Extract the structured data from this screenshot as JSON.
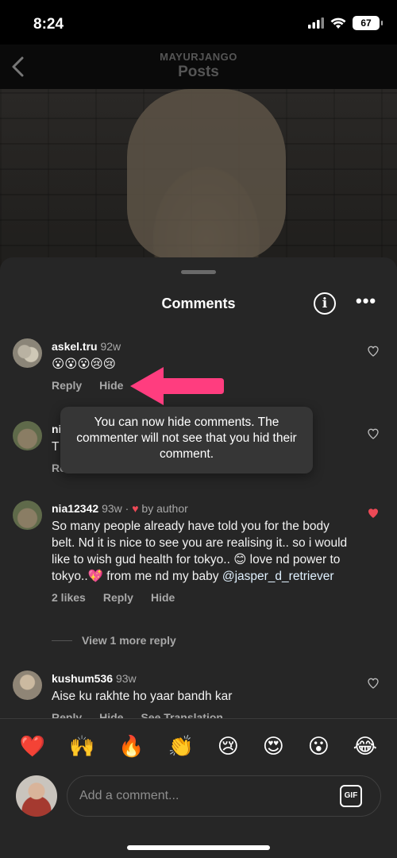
{
  "status_bar": {
    "time": "8:24",
    "battery": "67"
  },
  "header": {
    "account": "MAYURJANGO",
    "title": "Posts"
  },
  "sheet": {
    "title": "Comments"
  },
  "comments": [
    {
      "user": "askel.tru",
      "time": "92w",
      "text": "😮😮😮😢😢",
      "actions": [
        "Reply",
        "Hide"
      ]
    },
    {
      "user": "ni",
      "time": "",
      "text": "T",
      "actions": [
        "Re"
      ]
    },
    {
      "user": "nia12342",
      "time": "93w",
      "liked_by_author": "by author",
      "text_before": "So many people already have told you for the body belt. Nd it is nice to see you are realising it.. so i would like to wish gud health for tokyo.. 😊 love nd power to tokyo..💖 from me nd my baby ",
      "mention": "@jasper_d_retriever",
      "actions": [
        "2 likes",
        "Reply",
        "Hide"
      ],
      "view_replies": "View 1 more reply"
    },
    {
      "user": "kushum536",
      "time": "93w",
      "text": "Aise ku rakhte ho yaar bandh kar",
      "actions": [
        "Reply",
        "Hide",
        "See Translation"
      ]
    }
  ],
  "tooltip": "You can now hide comments. The commenter will not see that you hid their comment.",
  "emoji_bar": [
    "❤️",
    "🙌",
    "🔥",
    "👏",
    "😢",
    "😍",
    "😮",
    "😂"
  ],
  "composer": {
    "placeholder": "Add a comment...",
    "gif_label": "GIF"
  },
  "colors": {
    "sheet_bg": "#262626",
    "accent_heart": "#ed4956",
    "arrow": "#ff3d7f"
  }
}
